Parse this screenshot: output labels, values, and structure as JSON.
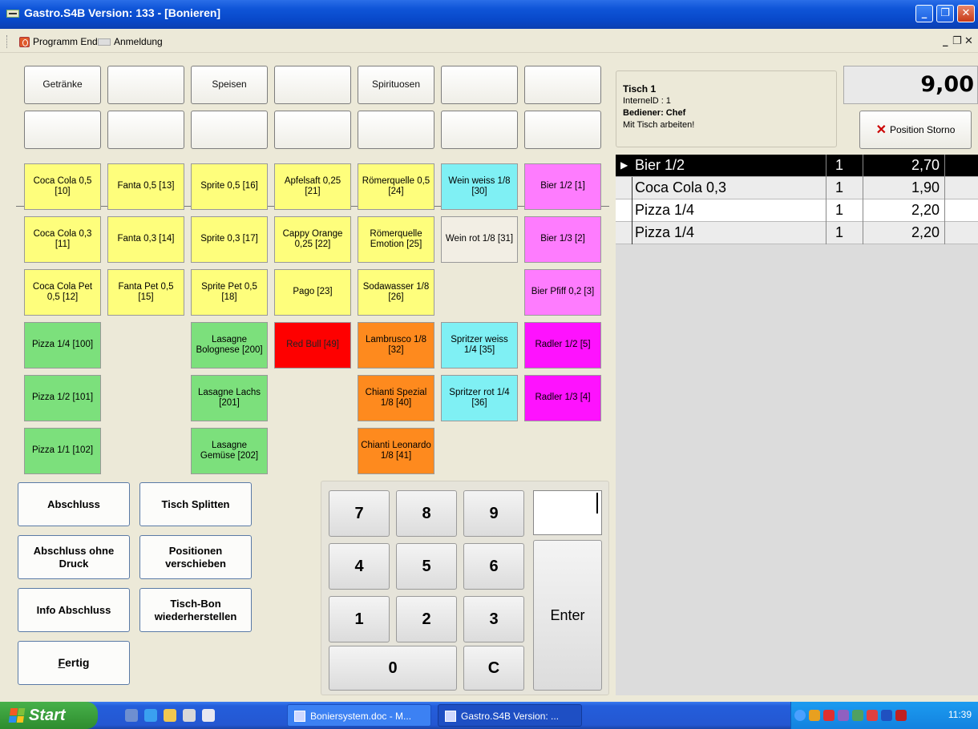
{
  "window": {
    "title": "Gastro.S4B Version:  133 - [Bonieren]"
  },
  "menu": {
    "exit": "Programm Ende",
    "login": "Anmeldung"
  },
  "categories": [
    "Getränke",
    "",
    "Speisen",
    "",
    "Spirituosen",
    "",
    "",
    "",
    "",
    "",
    "",
    "",
    "",
    ""
  ],
  "products": {
    "coca05": "Coca Cola 0,5 [10]",
    "fanta05": "Fanta 0,5 [13]",
    "sprite05": "Sprite 0,5 [16]",
    "apfelsaft": "Apfelsaft 0,25 [21]",
    "roemer05": "Römerquelle 0,5 [24]",
    "weinweiss": "Wein weiss 1/8 [30]",
    "bier12": "Bier 1/2 [1]",
    "coca03": "Coca Cola 0,3 [11]",
    "fanta03": "Fanta  0,3 [14]",
    "sprite03": "Sprite 0,3 [17]",
    "cappy": "Cappy Orange 0,25 [22]",
    "roemeremo": "Römerquelle Emotion [25]",
    "weinrot": "Wein rot 1/8 [31]",
    "bier13": "Bier 1/3 [2]",
    "cocapet": "Coca Cola Pet 0,5 [12]",
    "fantapet": "Fanta Pet 0,5 [15]",
    "spritepet": "Sprite Pet 0,5 [18]",
    "pago": "Pago  [23]",
    "soda": "Sodawasser 1/8 [26]",
    "bierpfiff": "Bier Pfiff 0,2 [3]",
    "pizza14": "Pizza 1/4 [100]",
    "lasbolo": "Lasagne Bolognese [200]",
    "redbull": "Red Bull  [49]",
    "lambrusco": "Lambrusco 1/8 [32]",
    "spritzweiss": "Spritzer weiss 1/4 [35]",
    "radler12": "Radler 1/2 [5]",
    "pizza12": "Pizza 1/2 [101]",
    "laslachs": "Lasagne Lachs [201]",
    "chiantisp": "Chianti Spezial 1/8 [40]",
    "spritzrot": "Spritzer rot 1/4 [36]",
    "radler13": "Radler 1/3 [4]",
    "pizza11": "Pizza 1/1 [102]",
    "lasgem": "Lasagne Gemüse [202]",
    "chiantileo": "Chianti Leonardo 1/8 [41]"
  },
  "actions": {
    "abschluss": "Abschluss",
    "splitten": "Tisch Splitten",
    "ohnedruck": "Abschluss ohne Druck",
    "verschieben": "Positionen verschieben",
    "info": "Info Abschluss",
    "bon": "Tisch-Bon wiederherstellen",
    "fertig_first": "F",
    "fertig_rest": "ertig"
  },
  "keypad": {
    "k7": "7",
    "k8": "8",
    "k9": "9",
    "k4": "4",
    "k5": "5",
    "k6": "6",
    "k1": "1",
    "k2": "2",
    "k3": "3",
    "k0": "0",
    "kc": "C",
    "enter": "Enter",
    "input_value": ""
  },
  "table_info": {
    "tisch": "Tisch  1",
    "internal_id": "InternelD : 1",
    "waiter": "Bediener: Chef",
    "mode": "Mit Tisch arbeiten!"
  },
  "total": "9,00",
  "storno_label": "Position Storno",
  "orders": [
    {
      "name": "Bier 1/2",
      "qty": "1",
      "price": "2,70"
    },
    {
      "name": "Coca Cola 0,3",
      "qty": "1",
      "price": "1,90"
    },
    {
      "name": "Pizza 1/4",
      "qty": "1",
      "price": "2,20"
    },
    {
      "name": "Pizza 1/4",
      "qty": "1",
      "price": "2,20"
    }
  ],
  "taskbar": {
    "start": "Start",
    "task1": "Boniersystem.doc - M...",
    "task2": "Gastro.S4B Version: ...",
    "clock": "11:39"
  },
  "colors": {
    "yellow": "#fefe7c",
    "green": "#7ce07c",
    "orange": "#fe8a1e",
    "red": "#fe0000",
    "cyan": "#7ff0f4",
    "pink": "#fe7cfe",
    "magenta": "#fe12fe",
    "selected_row": "#000000"
  }
}
